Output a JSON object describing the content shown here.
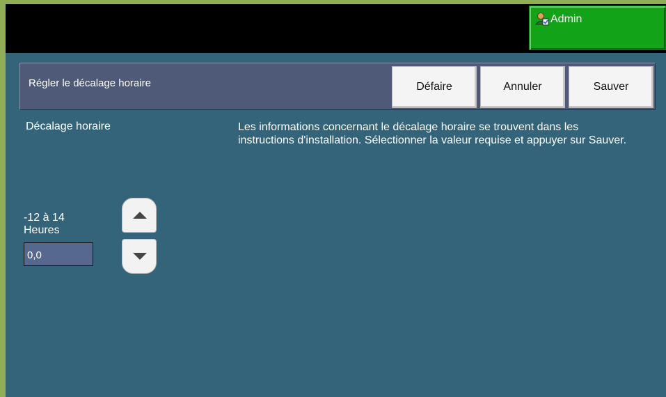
{
  "header": {
    "admin_label": "Admin",
    "admin_icon": "admin-user-icon",
    "accent_color": "#12a319"
  },
  "toolbar": {
    "title": "Régler le décalage horaire",
    "undo_label": "Défaire",
    "cancel_label": "Annuler",
    "save_label": "Sauver"
  },
  "main": {
    "field_label": "Décalage horaire",
    "help_text": "Les informations concernant le décalage horaire se trouvent dans les instructions d'installation. Sélectionner la valeur requise et appuyer sur Sauver.",
    "range_line1": "-12 à 14",
    "range_line2": "Heures",
    "value": "0,0",
    "up_icon": "arrow-up-icon",
    "down_icon": "arrow-down-icon"
  }
}
